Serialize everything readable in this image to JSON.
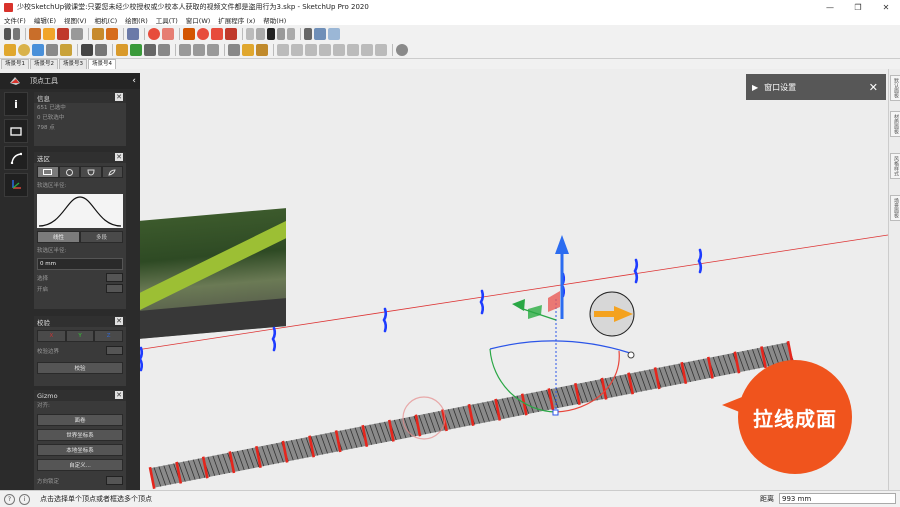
{
  "window": {
    "title": "少校SketchUp微课堂:只要您未经少校授权或少校本人获取的视频文件都是盗用行为3.skp - SketchUp Pro 2020",
    "minimize": "—",
    "maximize": "❐",
    "close": "✕"
  },
  "menu": [
    "文件(F)",
    "编辑(E)",
    "视图(V)",
    "相机(C)",
    "绘图(R)",
    "工具(T)",
    "窗口(W)",
    "扩展程序 (x)",
    "帮助(H)"
  ],
  "scene_tabs": [
    "场景号1",
    "场景号2",
    "场景号3",
    "场景号4"
  ],
  "active_tab": 3,
  "vertex_panel": {
    "title": "顶点工具",
    "collapse": "‹",
    "strip": {
      "info": "i"
    },
    "info": {
      "title": "信息",
      "lines": [
        "651 已选中",
        "0 已软选中",
        "798 点"
      ]
    },
    "selection": {
      "title": "选区",
      "falloff_label": "软选区半径:",
      "tab_linear": "线性",
      "tab_poly": "多段",
      "radius_label": "软选区半径:",
      "radius_value": "0 mm",
      "opt1": "选择",
      "opt2": "开启"
    },
    "edit": {
      "title": "校验",
      "axes": [
        "X",
        "Y",
        "Z"
      ],
      "bounds_label": "校验边界",
      "button": "校验"
    },
    "gizmo": {
      "title": "Gizmo",
      "align_label": "对齐:",
      "buttons": [
        "面卷",
        "世界坐标系",
        "本地坐标系",
        "自定义..."
      ],
      "bottom_label": "方向锁定"
    },
    "close_glyph": "✕"
  },
  "right_tray": {
    "title": "窗口设置",
    "chevron": "▶",
    "close": "✕",
    "side_tabs": [
      "默认面板",
      "材质面板",
      "风格样式",
      "场景面板"
    ]
  },
  "overlay": {
    "badge_text": "拉线成面"
  },
  "status": {
    "message": "点击选择单个顶点或者框选多个顶点",
    "measure_label": "距离",
    "measure_value": "993 mm",
    "help": "?",
    "info": "i"
  },
  "colors": {
    "accent": "#f0541d",
    "panel_bg": "#2b2b2b",
    "curve_red": "#e5261d",
    "curve_blue": "#1e3cff"
  }
}
